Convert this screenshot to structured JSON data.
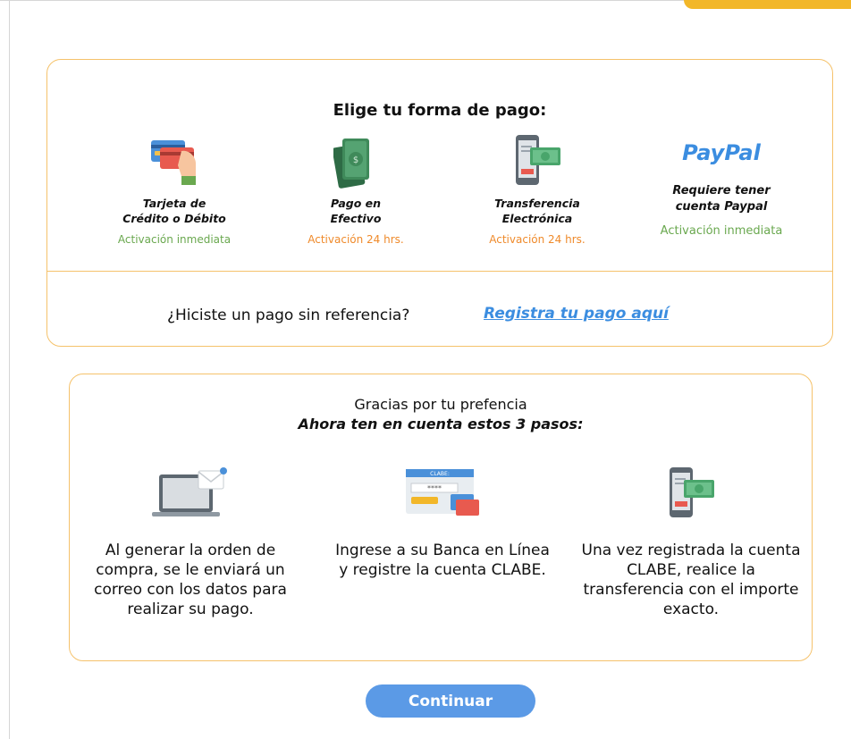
{
  "payment": {
    "title": "Elige tu forma de pago:",
    "methods": [
      {
        "icon": "credit-card-hand-icon",
        "label_line1": "Tarjeta de",
        "label_line2": "Crédito o Débito",
        "activation": "Activación inmediata",
        "activation_color": "#6aa84f"
      },
      {
        "icon": "cash-money-icon",
        "label_line1": "Pago en",
        "label_line2": "Efectivo",
        "activation": "Activación 24 hrs.",
        "activation_color": "#ef8a2b"
      },
      {
        "icon": "phone-transfer-icon",
        "label_line1": "Transferencia",
        "label_line2": "Electrónica",
        "activation": "Activación 24 hrs.",
        "activation_color": "#ef8a2b"
      },
      {
        "icon": "paypal-logo",
        "logo_text": "PayPal",
        "label_line1": "Requiere tener",
        "label_line2": "cuenta Paypal",
        "activation": "Activación inmediata",
        "activation_color": "#6aa84f"
      }
    ],
    "no_reference_question": "¿Hiciste un pago sin referencia?",
    "register_link": "Registra tu pago aquí"
  },
  "steps": {
    "thanks": "Gracias por tu prefencia",
    "subtitle": "Ahora ten en cuenta estos 3 pasos:",
    "items": [
      {
        "icon": "laptop-email-icon",
        "text": "Al generar la orden de compra, se le enviará un correo con los datos para realizar su pago."
      },
      {
        "icon": "clabe-banking-icon",
        "text": "Ingrese a su Banca en Línea y registre la cuenta CLABE."
      },
      {
        "icon": "phone-transfer-icon",
        "text": "Una vez registrada la cuenta CLABE, realice la transferencia con el importe exacto."
      }
    ]
  },
  "continue_label": "Continuar",
  "colors": {
    "accent_border": "#f5c26b",
    "primary_blue": "#5b9ae6",
    "link_blue": "#3b8de0",
    "green": "#6aa84f",
    "orange": "#ef8a2b",
    "corner_yellow": "#f2b729"
  }
}
